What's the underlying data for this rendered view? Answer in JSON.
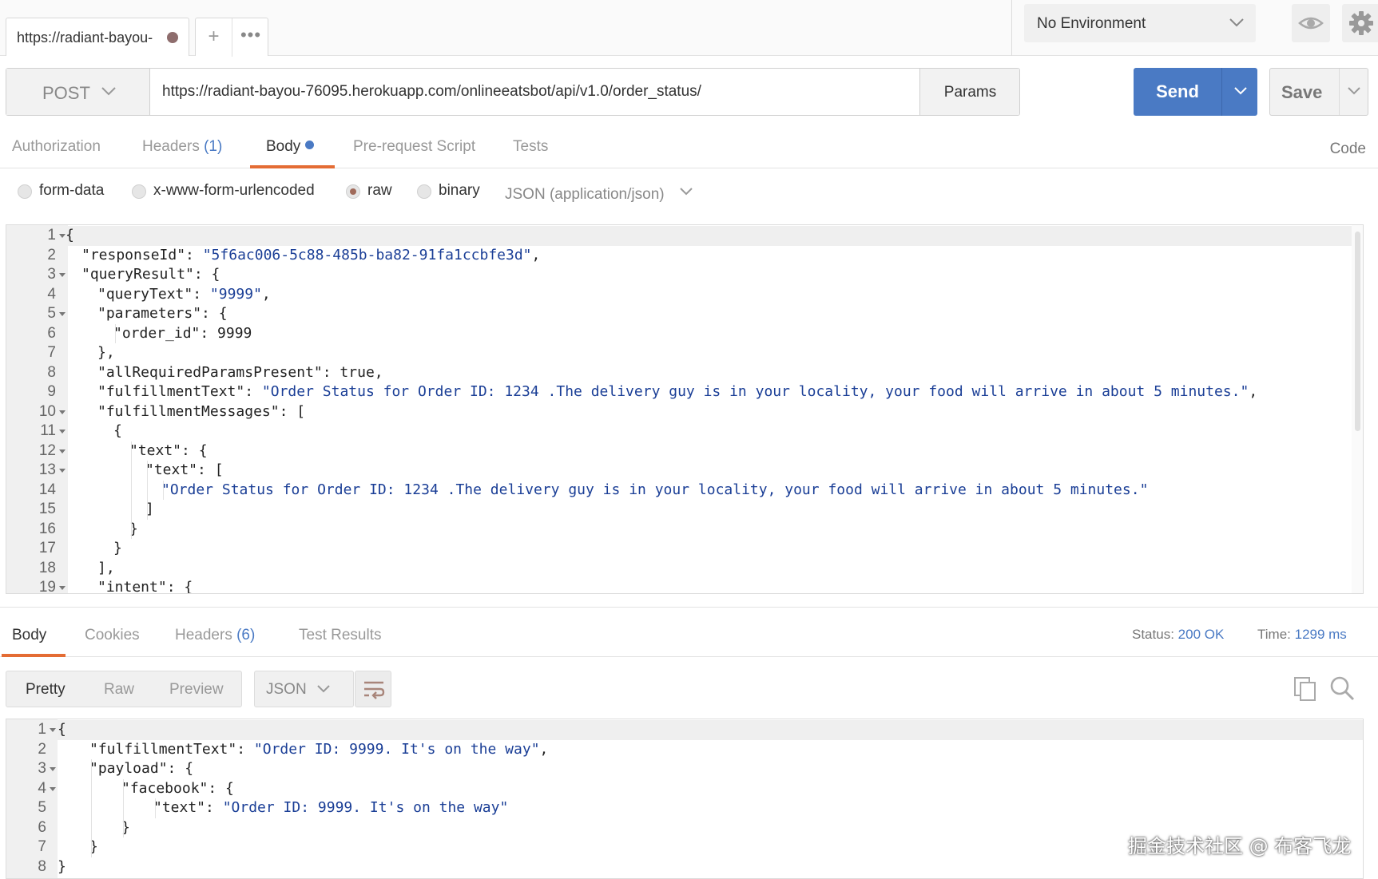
{
  "tab": {
    "title": "https://radiant-bayou-",
    "add_label": "+",
    "more_label": "•••"
  },
  "environment": {
    "selected": "No Environment"
  },
  "request": {
    "method": "POST",
    "url": "https://radiant-bayou-76095.herokuapp.com/onlineeatsbot/api/v1.0/order_status/",
    "params_label": "Params",
    "send_label": "Send",
    "save_label": "Save"
  },
  "request_tabs": [
    {
      "label": "Authorization",
      "count": ""
    },
    {
      "label": "Headers",
      "count": "(1)"
    },
    {
      "label": "Body",
      "count": ""
    },
    {
      "label": "Pre-request Script",
      "count": ""
    },
    {
      "label": "Tests",
      "count": ""
    }
  ],
  "code_link": "Code",
  "body_types": {
    "options": [
      "form-data",
      "x-www-form-urlencoded",
      "raw",
      "binary"
    ],
    "selected": "raw",
    "content_type": "JSON (application/json)"
  },
  "request_body": {
    "lines": [
      {
        "n": "1",
        "fold": true,
        "indent": 0,
        "text": "{",
        "str": "",
        "post": ""
      },
      {
        "n": "2",
        "fold": false,
        "indent": 1,
        "text": "\"responseId\": ",
        "str": "\"5f6ac006-5c88-485b-ba82-91fa1ccbfe3d\"",
        "post": ","
      },
      {
        "n": "3",
        "fold": true,
        "indent": 1,
        "text": "\"queryResult\": {",
        "str": "",
        "post": ""
      },
      {
        "n": "4",
        "fold": false,
        "indent": 2,
        "text": "\"queryText\": ",
        "str": "\"9999\"",
        "post": ","
      },
      {
        "n": "5",
        "fold": true,
        "indent": 2,
        "text": "\"parameters\": {",
        "str": "",
        "post": ""
      },
      {
        "n": "6",
        "fold": false,
        "indent": 3,
        "text": "\"order_id\": 9999",
        "str": "",
        "post": ""
      },
      {
        "n": "7",
        "fold": false,
        "indent": 2,
        "text": "},",
        "str": "",
        "post": ""
      },
      {
        "n": "8",
        "fold": false,
        "indent": 2,
        "text": "\"allRequiredParamsPresent\": true,",
        "str": "",
        "post": ""
      },
      {
        "n": "9",
        "fold": false,
        "indent": 2,
        "text": "\"fulfillmentText\": ",
        "str": "\"Order Status for Order ID: 1234 .The delivery guy is in your locality, your food will arrive in about 5 minutes.\"",
        "post": ","
      },
      {
        "n": "10",
        "fold": true,
        "indent": 2,
        "text": "\"fulfillmentMessages\": [",
        "str": "",
        "post": ""
      },
      {
        "n": "11",
        "fold": true,
        "indent": 3,
        "text": "{",
        "str": "",
        "post": ""
      },
      {
        "n": "12",
        "fold": true,
        "indent": 4,
        "text": "\"text\": {",
        "str": "",
        "post": ""
      },
      {
        "n": "13",
        "fold": true,
        "indent": 5,
        "text": "\"text\": [",
        "str": "",
        "post": ""
      },
      {
        "n": "14",
        "fold": false,
        "indent": 6,
        "text": "",
        "str": "\"Order Status for Order ID: 1234 .The delivery guy is in your locality, your food will arrive in about 5 minutes.\"",
        "post": ""
      },
      {
        "n": "15",
        "fold": false,
        "indent": 5,
        "text": "]",
        "str": "",
        "post": ""
      },
      {
        "n": "16",
        "fold": false,
        "indent": 4,
        "text": "}",
        "str": "",
        "post": ""
      },
      {
        "n": "17",
        "fold": false,
        "indent": 3,
        "text": "}",
        "str": "",
        "post": ""
      },
      {
        "n": "18",
        "fold": false,
        "indent": 2,
        "text": "],",
        "str": "",
        "post": ""
      },
      {
        "n": "19",
        "fold": true,
        "indent": 2,
        "text": "\"intent\": {",
        "str": "",
        "post": ""
      }
    ]
  },
  "response_tabs": [
    {
      "label": "Body",
      "count": ""
    },
    {
      "label": "Cookies",
      "count": ""
    },
    {
      "label": "Headers",
      "count": "(6)"
    },
    {
      "label": "Test Results",
      "count": ""
    }
  ],
  "response_meta": {
    "status_label": "Status:",
    "status_value": "200 OK",
    "time_label": "Time:",
    "time_value": "1299 ms"
  },
  "response_view": {
    "modes": [
      "Pretty",
      "Raw",
      "Preview"
    ],
    "selected": "Pretty",
    "format": "JSON"
  },
  "response_body": {
    "lines": [
      {
        "n": "1",
        "fold": true,
        "indent": 0,
        "text": "{",
        "str": "",
        "post": ""
      },
      {
        "n": "2",
        "fold": false,
        "indent": 1,
        "text": "\"fulfillmentText\": ",
        "str": "\"Order ID: 9999. It's on the way\"",
        "post": ","
      },
      {
        "n": "3",
        "fold": true,
        "indent": 1,
        "text": "\"payload\": {",
        "str": "",
        "post": ""
      },
      {
        "n": "4",
        "fold": true,
        "indent": 2,
        "text": "\"facebook\": {",
        "str": "",
        "post": ""
      },
      {
        "n": "5",
        "fold": false,
        "indent": 3,
        "text": "\"text\": ",
        "str": "\"Order ID: 9999. It's on the way\"",
        "post": ""
      },
      {
        "n": "6",
        "fold": false,
        "indent": 2,
        "text": "}",
        "str": "",
        "post": ""
      },
      {
        "n": "7",
        "fold": false,
        "indent": 1,
        "text": "}",
        "str": "",
        "post": ""
      },
      {
        "n": "8",
        "fold": false,
        "indent": 0,
        "text": "}",
        "str": "",
        "post": ""
      }
    ]
  },
  "watermark": "掘金技术社区 @ 布客飞龙",
  "colors": {
    "accent": "#4a7ac4",
    "tab_underline": "#e46c34",
    "string": "#1a3e96",
    "unsaved_dot": "#8e6d6d"
  }
}
